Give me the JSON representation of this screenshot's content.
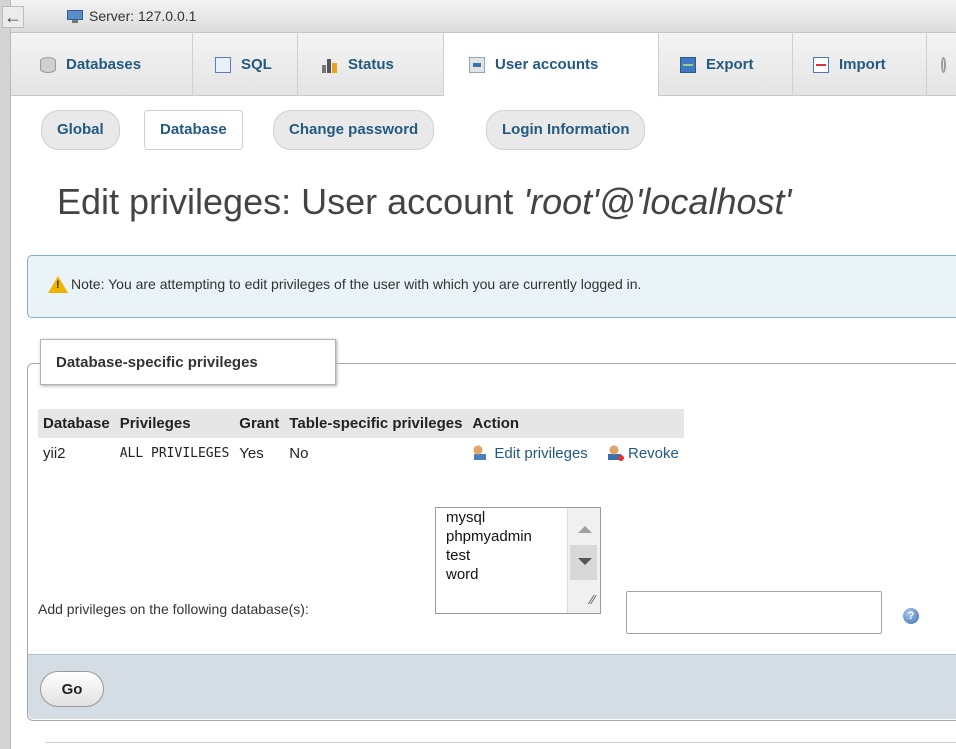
{
  "server_bar": {
    "back_glyph": "←",
    "label": "Server: 127.0.0.1",
    "icon": "server-icon"
  },
  "tabs": [
    {
      "label": "Databases",
      "icon": "database-icon"
    },
    {
      "label": "SQL",
      "icon": "sql-icon"
    },
    {
      "label": "Status",
      "icon": "status-icon"
    },
    {
      "label": "User accounts",
      "icon": "user-accounts-icon",
      "active": true
    },
    {
      "label": "Export",
      "icon": "export-icon"
    },
    {
      "label": "Import",
      "icon": "import-icon"
    },
    {
      "label": "",
      "icon": "wrench-icon"
    }
  ],
  "subtabs": [
    {
      "label": "Global"
    },
    {
      "label": "Database",
      "active": true
    },
    {
      "label": "Change password"
    },
    {
      "label": "Login Information"
    }
  ],
  "page": {
    "title_prefix": "Edit privileges: User account ",
    "title_user": "'root'@'localhost'"
  },
  "notice": {
    "text": "Note: You are attempting to edit privileges of the user with which you are currently logged in.",
    "icon": "warning-icon"
  },
  "db_privileges": {
    "legend": "Database-specific privileges",
    "columns": [
      "Database",
      "Privileges",
      "Grant",
      "Table-specific privileges",
      "Action"
    ],
    "rows": [
      {
        "database": "yii2",
        "privileges": "ALL PRIVILEGES",
        "grant": "Yes",
        "table_specific": "No",
        "edit_label": "Edit privileges",
        "revoke_label": "Revoke"
      }
    ],
    "add_label": "Add privileges on the following database(s):",
    "database_options": [
      "mysql",
      "phpmyadmin",
      "test",
      "word"
    ],
    "text_input_value": "",
    "help_glyph": "?",
    "go_label": "Go"
  },
  "colors": {
    "link": "#235a81",
    "notice_bg": "#e9f3f8",
    "footer_bg": "#d4dce4"
  }
}
